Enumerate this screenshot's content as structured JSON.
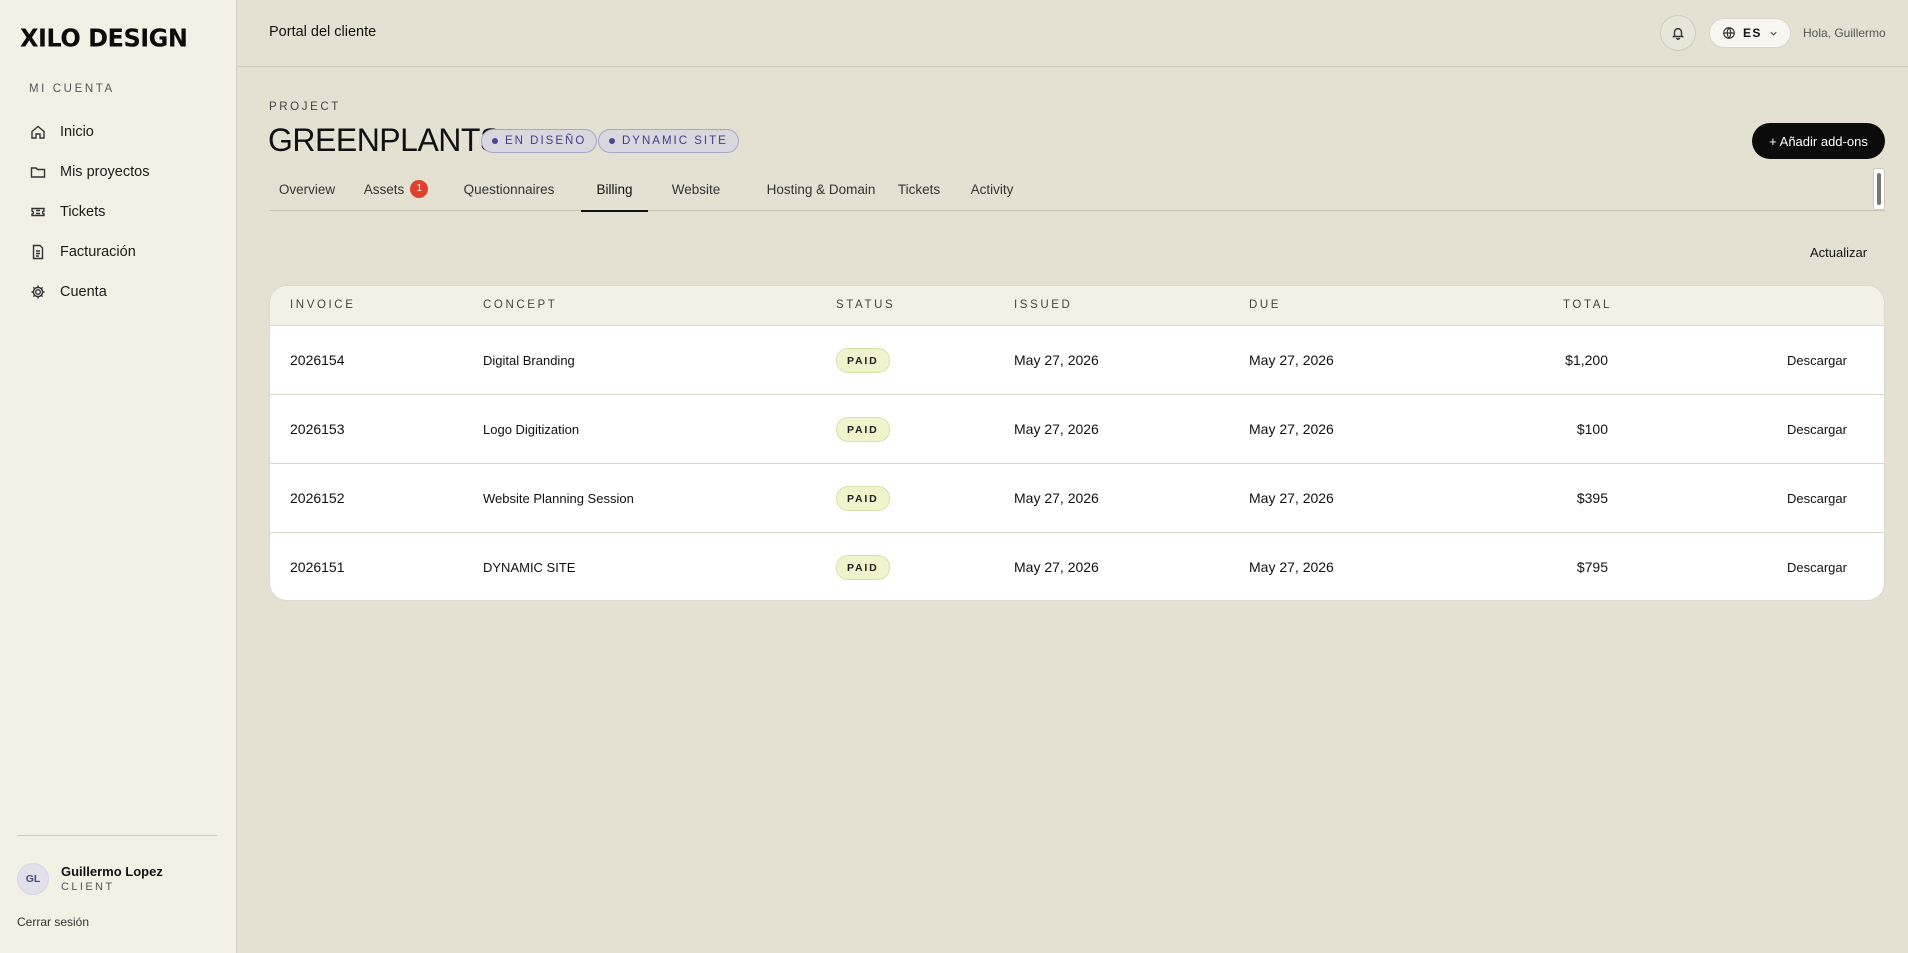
{
  "brand": {
    "logo_text": "XILO DESIGN"
  },
  "sidebar": {
    "section_label": "MI CUENTA",
    "items": [
      {
        "label": "Inicio",
        "icon": "home-icon"
      },
      {
        "label": "Mis proyectos",
        "icon": "folder-icon"
      },
      {
        "label": "Tickets",
        "icon": "ticket-icon"
      },
      {
        "label": "Facturación",
        "icon": "document-icon"
      },
      {
        "label": "Cuenta",
        "icon": "gear-icon"
      }
    ],
    "user": {
      "initials": "GL",
      "name": "Guillermo Lopez",
      "role": "CLIENT"
    },
    "logout_label": "Cerrar sesión"
  },
  "topbar": {
    "title": "Portal del cliente",
    "language_code": "ES",
    "greeting": "Hola, Guillermo"
  },
  "project": {
    "label": "PROJECT",
    "name": "GREENPLANTS",
    "phase_badge": "EN DISEÑO",
    "type_badge": "DYNAMIC SITE",
    "addon_button": "+ Añadir add-ons"
  },
  "tabs": [
    {
      "label": "Overview"
    },
    {
      "label": "Assets",
      "count": "1"
    },
    {
      "label": "Questionnaires"
    },
    {
      "label": "Billing",
      "active": true
    },
    {
      "label": "Website"
    },
    {
      "label": "Hosting & Domain"
    },
    {
      "label": "Tickets"
    },
    {
      "label": "Activity"
    }
  ],
  "billing": {
    "refresh_label": "Actualizar",
    "columns": [
      "INVOICE",
      "CONCEPT",
      "STATUS",
      "ISSUED",
      "DUE",
      "TOTAL"
    ],
    "download_label": "Descargar",
    "rows": [
      {
        "invoice": "2026154",
        "concept": "Digital Branding",
        "status": "PAID",
        "issued": "May 27, 2026",
        "due": "May 27, 2026",
        "total": "$1,200"
      },
      {
        "invoice": "2026153",
        "concept": "Logo Digitization",
        "status": "PAID",
        "issued": "May 27, 2026",
        "due": "May 27, 2026",
        "total": "$100"
      },
      {
        "invoice": "2026152",
        "concept": "Website Planning Session",
        "status": "PAID",
        "issued": "May 27, 2026",
        "due": "May 27, 2026",
        "total": "$395"
      },
      {
        "invoice": "2026151",
        "concept": "DYNAMIC SITE",
        "status": "PAID",
        "issued": "May 27, 2026",
        "due": "May 27, 2026",
        "total": "$795"
      }
    ]
  },
  "colors": {
    "page_bg": "#e4e0d2",
    "sidebar_bg": "#f3f1e6",
    "accent_dark": "#0b0b0b",
    "badge_purple": "#3f3e8c",
    "paid_bg": "#eff4cc",
    "count_badge": "#e0412c"
  }
}
